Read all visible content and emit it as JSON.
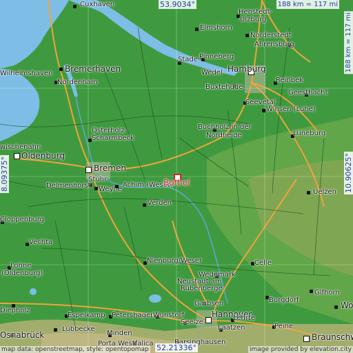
{
  "map": {
    "center_label": "Bothel",
    "coords": {
      "top_lat": "53.9034°",
      "bottom_lat": "52.21336°",
      "left_lon": "8.09375°",
      "right_lon": "10.90625°"
    },
    "scale": {
      "top": "188 km = 117 mi",
      "right": "188 km = 117 mi"
    },
    "attribution_left": "map data: openstreetmap, style: opentopomap",
    "attribution_right": "image provided by elevation.city",
    "colors": {
      "water": "#7dbde6",
      "lowland": "#3f9a3f",
      "highland": "#8ca858",
      "road": "#f2a33a",
      "marker": "#d0282e"
    },
    "places": {
      "cuxhaven": "Cuxhaven",
      "henstedt": "Henstedt-",
      "ulzburg": "Ulzburg",
      "elmshorn": "Elmshorn",
      "norderstedt": "Norderstedt",
      "ahrensburg": "Ahrensburg",
      "bremerhaven": "Bremerhaven",
      "stade": "Stade",
      "pinneberg": "Pinneberg",
      "hamburg": "Hamburg",
      "wilhelmshaven": "Wilhelmshaven",
      "nordenham": "Nordenham",
      "wedel": "Wedel",
      "buxtehude": "Buxtehude",
      "reinbek": "Reinbek",
      "geesthacht": "Geesthacht",
      "seevetal": "Seevetal",
      "winsen": "Winsen (Luhe)",
      "buchholz1": "Buchholz in der",
      "buchholz2": "Nordheide",
      "lueneburg": "Lüneburg",
      "osterholz1": "Osterholz-",
      "osterholz2": "Scharmbeck",
      "varel": "wischenahn",
      "oldenburg": "Oldenburg",
      "bremen": "Bremen",
      "stuhr": "Stuhr",
      "delmenhorst": "Delmenhorst",
      "weyhe": "Weyhe",
      "achim": "Achim (Weser)",
      "uelzen": "Uelzen",
      "verden": "Verden",
      "cloppenburg": "Cloppenburg",
      "vechta": "Vechta",
      "celle": "Celle",
      "lohne1": "Lohne",
      "lohne2": "(Oldenburg)",
      "nienburg": "Nienburg/Weser",
      "wedemark": "Wedemark",
      "neustadt1": "Neustadt am",
      "neustadt2": "Rübenberge",
      "gifhorn": "Gifhorn",
      "burgdorf": "Burgdorf",
      "diepholz": "Diepholz",
      "garbsen": "Garbsen",
      "wolfsburg": "Wo",
      "espelkamp": "Espelkamp",
      "petershagen": "Petershagen",
      "wunstorf": "Wunstorf",
      "hannover": "Hannover",
      "lehrte": "Lehrte",
      "seelze": "Seelze",
      "osnabrueck": "Osnabrück",
      "luebbecke": "Lübbecke",
      "minden": "Minden",
      "laatzen": "Laatzen",
      "peine": "Peine",
      "braunschweig": "Braunschw",
      "porta": "Porta Westfalica",
      "barsinghausen": "Barsinghausen"
    }
  }
}
